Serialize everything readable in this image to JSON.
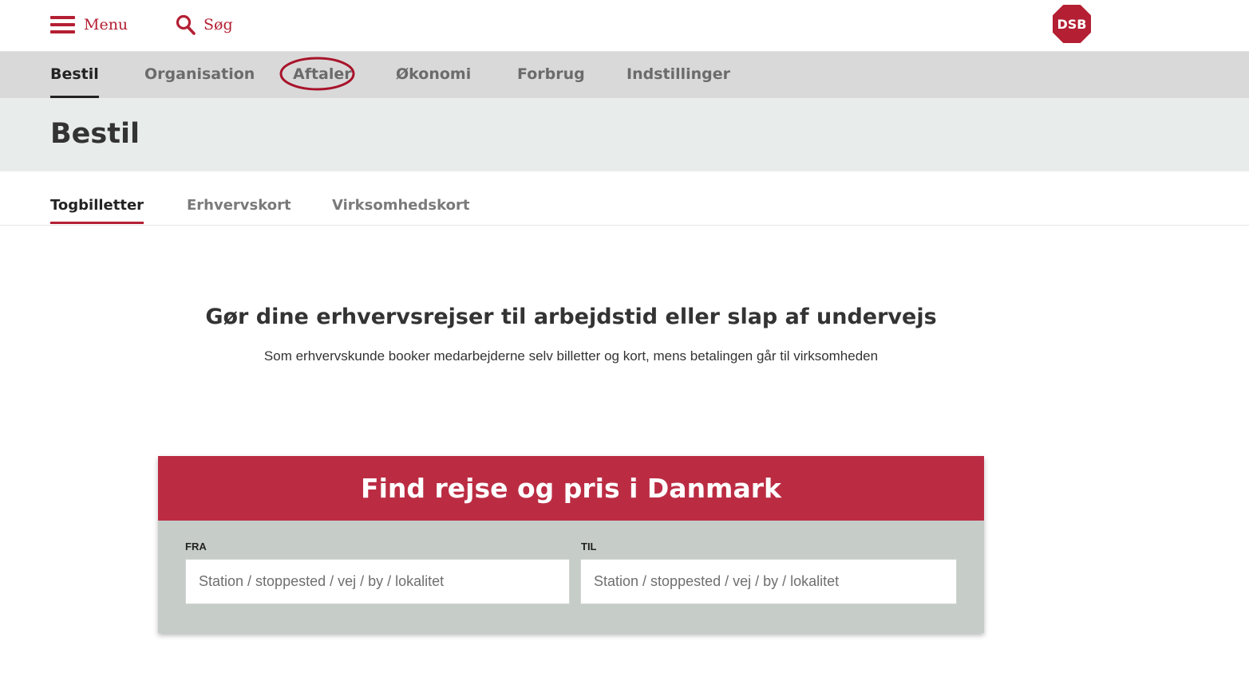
{
  "header": {
    "menu_label": "Menu",
    "search_label": "Søg",
    "logo_text": "DSB",
    "brand_color": "#b41f33"
  },
  "main_nav": {
    "items": [
      {
        "label": "Bestil",
        "active": true
      },
      {
        "label": "Organisation",
        "active": false
      },
      {
        "label": "Aftaler",
        "active": false,
        "highlighted": true
      },
      {
        "label": "Økonomi",
        "active": false
      },
      {
        "label": "Forbrug",
        "active": false
      },
      {
        "label": "Indstillinger",
        "active": false
      }
    ]
  },
  "page": {
    "title": "Bestil"
  },
  "sub_nav": {
    "items": [
      {
        "label": "Togbilletter",
        "active": true
      },
      {
        "label": "Erhvervskort",
        "active": false
      },
      {
        "label": "Virksomhedskort",
        "active": false
      }
    ]
  },
  "intro": {
    "heading": "Gør dine erhvervsrejser til arbejdstid eller slap af undervejs",
    "text": "Som erhvervskunde booker medarbejderne selv billetter og kort, mens betalingen går til virksomheden"
  },
  "journey_search": {
    "title": "Find rejse og pris i Danmark",
    "header_color": "#bb2c43",
    "from": {
      "label": "FRA",
      "value": "",
      "placeholder": "Station / stoppested / vej / by / lokalitet"
    },
    "to": {
      "label": "TIL",
      "value": "",
      "placeholder": "Station / stoppested / vej / by / lokalitet"
    }
  }
}
